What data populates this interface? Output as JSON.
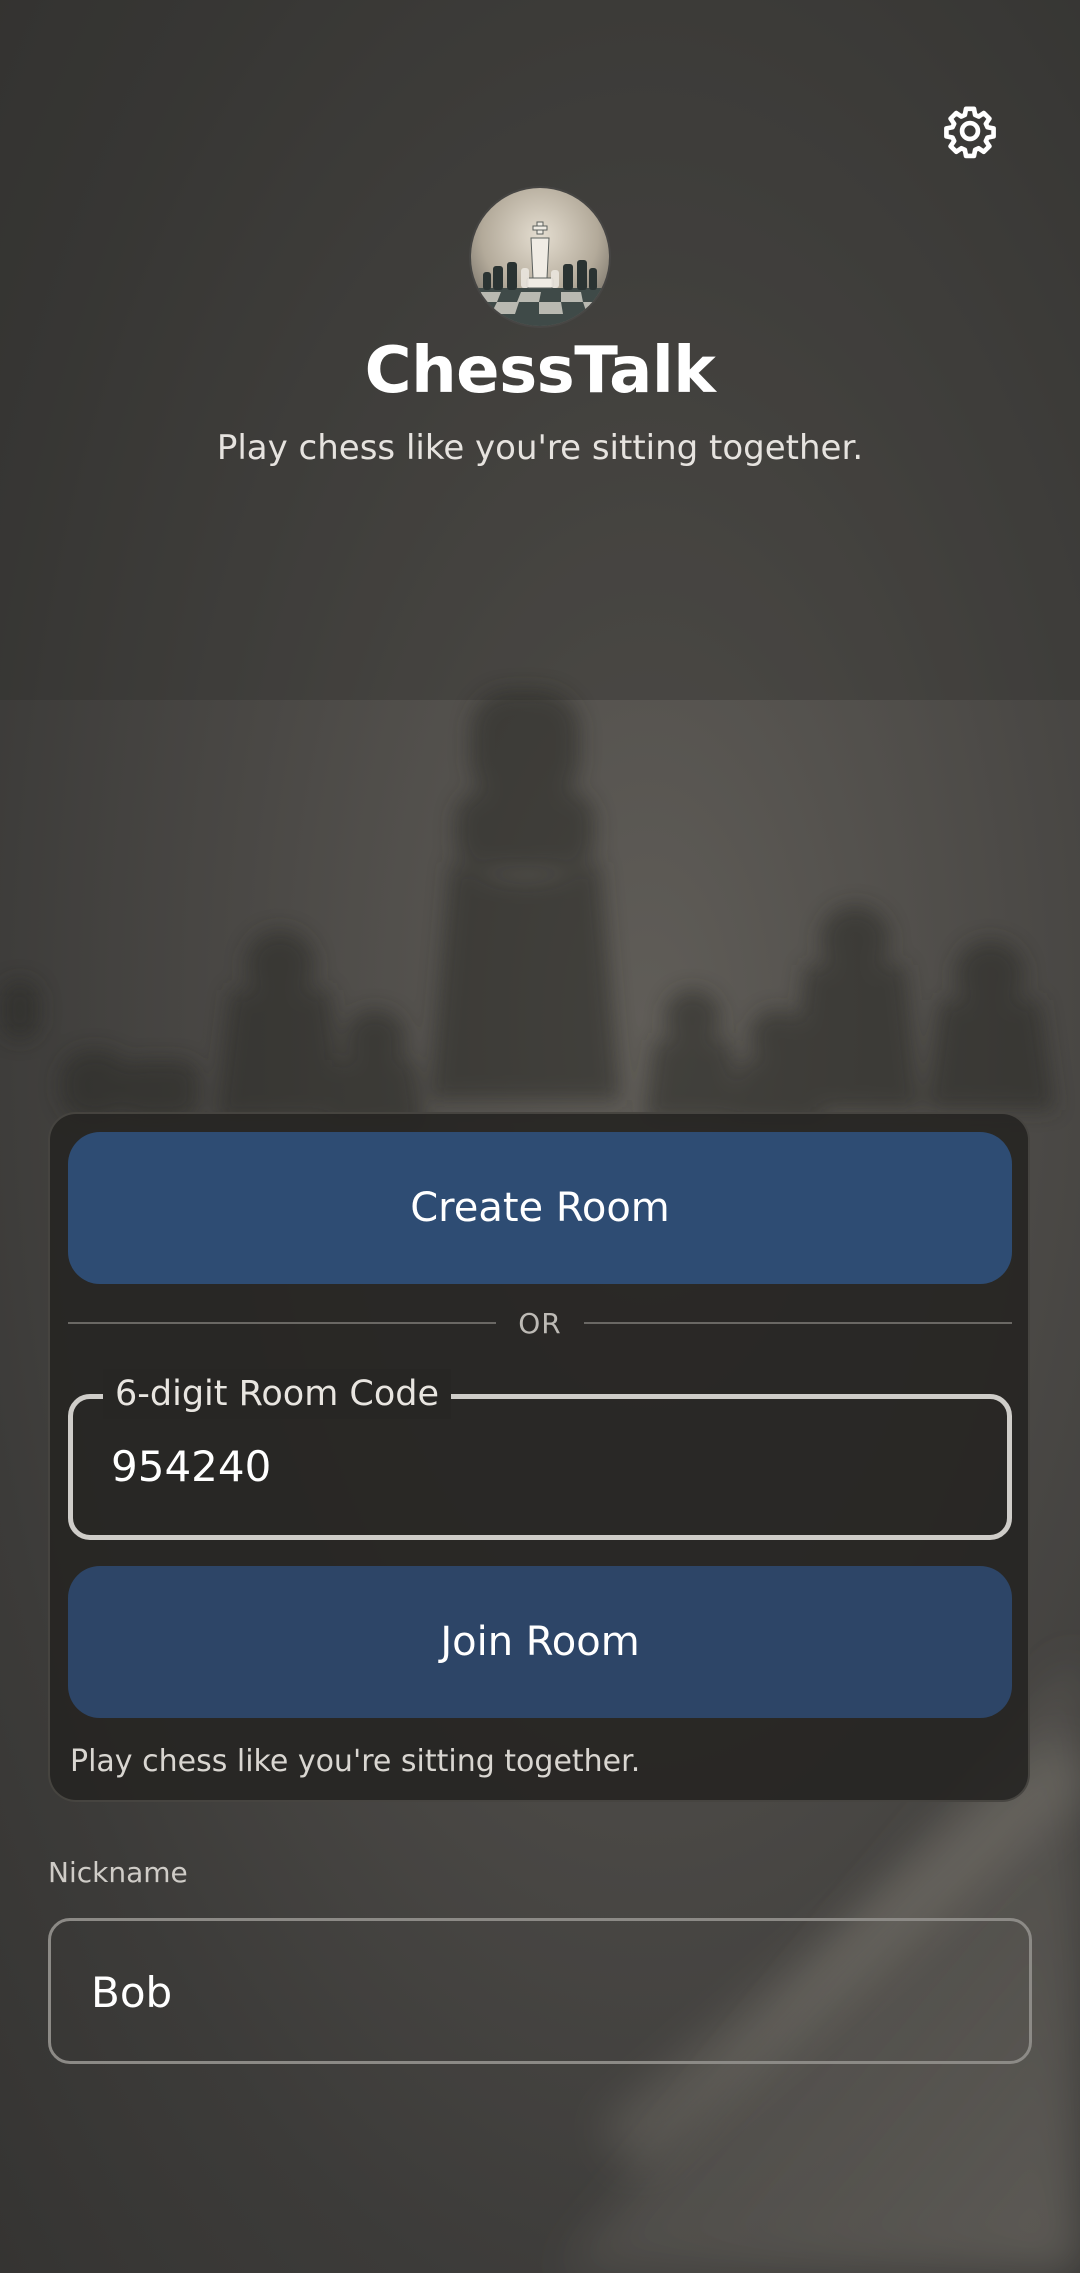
{
  "header": {
    "settings_icon": "gear-icon",
    "logo_alt": "chess-logo",
    "title": "ChessTalk",
    "subtitle": "Play chess like you're sitting together."
  },
  "card": {
    "create_label": "Create Room",
    "or_text": "OR",
    "code_label": "6-digit Room Code",
    "code_value": "954240",
    "join_label": "Join Room",
    "footer_text": "Play chess like you're sitting together."
  },
  "nickname": {
    "label": "Nickname",
    "value": "Bob"
  },
  "colors": {
    "button_bg": "#2e4c73",
    "card_bg": "#262523",
    "background": "#4a4845"
  }
}
